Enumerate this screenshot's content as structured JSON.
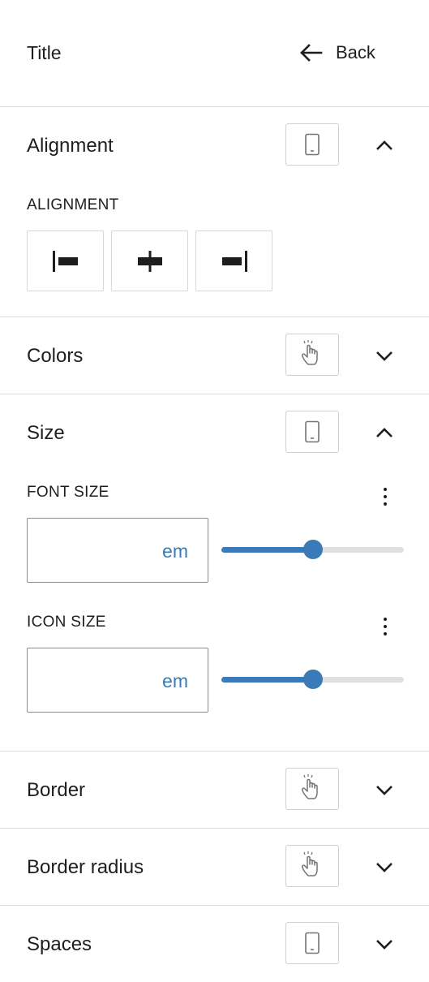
{
  "header": {
    "title": "Title",
    "back_label": "Back"
  },
  "sections": {
    "alignment": {
      "title": "Alignment",
      "device": "phone-icon",
      "expanded": true,
      "label": "ALIGNMENT",
      "options": [
        "align-left-icon",
        "align-center-icon",
        "align-right-icon"
      ]
    },
    "colors": {
      "title": "Colors",
      "device": "hover-hand-icon",
      "expanded": false
    },
    "size": {
      "title": "Size",
      "device": "phone-icon",
      "expanded": true,
      "font_size": {
        "label": "FONT SIZE",
        "unit": "em",
        "value": "",
        "slider_fraction": 0.5
      },
      "icon_size": {
        "label": "ICON SIZE",
        "unit": "em",
        "value": "",
        "slider_fraction": 0.5
      }
    },
    "border": {
      "title": "Border",
      "device": "hover-hand-icon",
      "expanded": false
    },
    "border_radius": {
      "title": "Border radius",
      "device": "hover-hand-icon",
      "expanded": false
    },
    "spaces": {
      "title": "Spaces",
      "device": "phone-icon",
      "expanded": false
    }
  },
  "colors": {
    "accent": "#3a7ab8",
    "text": "#1e1e1e",
    "divider": "#dcdcdc"
  }
}
